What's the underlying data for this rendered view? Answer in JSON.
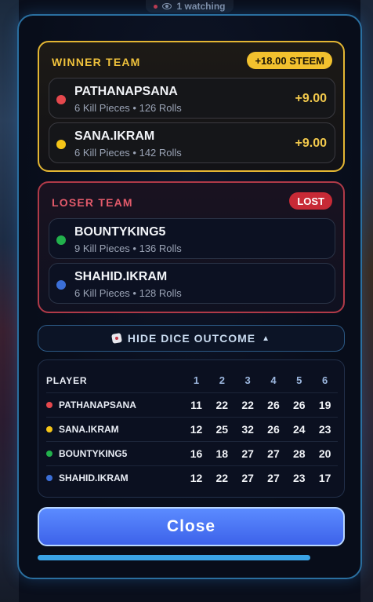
{
  "header": {
    "watching_label": "1 watching"
  },
  "winner": {
    "title": "WINNER TEAM",
    "badge": "+18.00 STEEM",
    "players": [
      {
        "name": "PATHANAPSANA",
        "stats": "6 Kill Pieces • 126 Rolls",
        "score": "+9.00",
        "color": "#e5484d"
      },
      {
        "name": "SANA.IKRAM",
        "stats": "6 Kill Pieces • 142 Rolls",
        "score": "+9.00",
        "color": "#f5c518"
      }
    ]
  },
  "loser": {
    "title": "LOSER TEAM",
    "badge": "LOST",
    "players": [
      {
        "name": "BOUNTYKING5",
        "stats": "9 Kill Pieces • 136 Rolls",
        "color": "#22b14c"
      },
      {
        "name": "SHAHID.IKRAM",
        "stats": "6 Kill Pieces • 128 Rolls",
        "color": "#3b6fd8"
      }
    ]
  },
  "dice_toggle": {
    "label": "HIDE DICE OUTCOME",
    "icon": "dice-icon",
    "caret": "▲"
  },
  "dice_table": {
    "header_player": "PLAYER",
    "columns": [
      "1",
      "2",
      "3",
      "4",
      "5",
      "6"
    ],
    "rows": [
      {
        "name": "PATHANAPSANA",
        "color": "#e5484d",
        "values": [
          "11",
          "22",
          "22",
          "26",
          "26",
          "19"
        ]
      },
      {
        "name": "SANA.IKRAM",
        "color": "#f5c518",
        "values": [
          "12",
          "25",
          "32",
          "26",
          "24",
          "23"
        ]
      },
      {
        "name": "BOUNTYKING5",
        "color": "#22b14c",
        "values": [
          "16",
          "18",
          "27",
          "27",
          "28",
          "20"
        ]
      },
      {
        "name": "SHAHID.IKRAM",
        "color": "#3b6fd8",
        "values": [
          "12",
          "22",
          "27",
          "27",
          "23",
          "17"
        ]
      }
    ]
  },
  "close_button": {
    "label": "Close"
  }
}
